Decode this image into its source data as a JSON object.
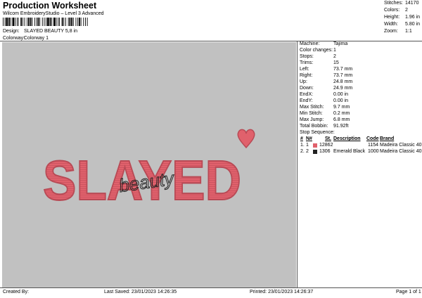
{
  "header": {
    "title": "Production Worksheet",
    "subtitle": "Wilcom EmbroideryStudio – Level 3 Advanced"
  },
  "design": {
    "label": "Design:",
    "value": "SLAYED BEAUTY 5,8 in"
  },
  "colorway": {
    "label": "Colorway:",
    "value": "Colorway 1"
  },
  "summary": [
    {
      "label": "Stitches:",
      "value": "14170"
    },
    {
      "label": "Colors:",
      "value": "2"
    },
    {
      "label": "Height:",
      "value": "1.96 in"
    },
    {
      "label": "Width:",
      "value": "5.80 in"
    },
    {
      "label": "Zoom:",
      "value": "1:1"
    }
  ],
  "details": [
    {
      "label": "Machine:",
      "value": "Tajima"
    },
    {
      "label": "Color changes:",
      "value": "1"
    },
    {
      "label": "Stops:",
      "value": "2"
    },
    {
      "label": "Trims:",
      "value": "15"
    },
    {
      "label": "Left:",
      "value": "73.7 mm"
    },
    {
      "label": "Right:",
      "value": "73.7 mm"
    },
    {
      "label": "Up:",
      "value": "24.8 mm"
    },
    {
      "label": "Down:",
      "value": "24.9 mm"
    },
    {
      "label": "EndX:",
      "value": "0.00 in"
    },
    {
      "label": "EndY:",
      "value": "0.00 in"
    },
    {
      "label": "Max Stitch:",
      "value": "9.7 mm"
    },
    {
      "label": "Min Stitch:",
      "value": "0.2 mm"
    },
    {
      "label": "Max Jump:",
      "value": "6.8 mm"
    },
    {
      "label": "Total Bobbin:",
      "value": "91.92ft"
    }
  ],
  "stop_sequence": {
    "title": "Stop Sequence:",
    "headers": {
      "num": "#",
      "n": "N#",
      "st": "St.",
      "desc": "Description",
      "code": "Code",
      "brand": "Brand"
    },
    "rows": [
      {
        "num": "1.",
        "n": "1",
        "color": "#e0616c",
        "st": "12862",
        "desc": "",
        "code": "1154",
        "brand": "Madeira Classic 40"
      },
      {
        "num": "2.",
        "n": "2",
        "color": "#222222",
        "st": "1306",
        "desc": "Emerald Black",
        "code": "1000",
        "brand": "Madeira Classic 40"
      }
    ]
  },
  "artwork": {
    "main_text": "SLAYED",
    "script_text": "beauty",
    "main_color": "#e0616c",
    "outline_color": "#b84a55",
    "script_color": "#222222",
    "background": "#c1c1c1"
  },
  "footer": {
    "created": "Created By:",
    "saved": "Last Saved: 23/01/2023 14:26:35",
    "printed": "Printed: 23/01/2023 14:26:37",
    "page": "Page 1 of 1"
  }
}
